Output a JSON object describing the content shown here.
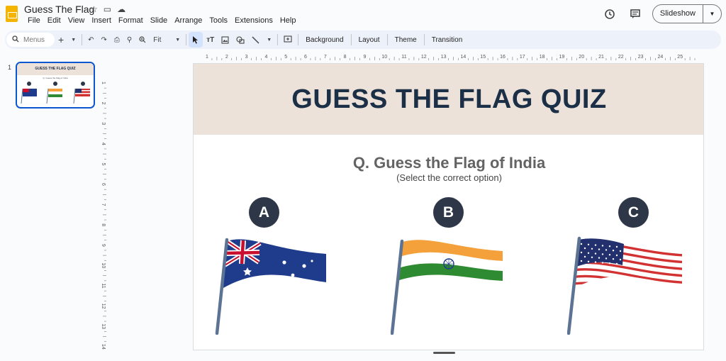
{
  "app": {
    "doc_title": "Guess The Flag",
    "menu": [
      "File",
      "Edit",
      "View",
      "Insert",
      "Format",
      "Slide",
      "Arrange",
      "Tools",
      "Extensions",
      "Help"
    ],
    "slideshow_label": "Slideshow"
  },
  "toolbar": {
    "search_placeholder": "Menus",
    "zoom": "Fit",
    "background_label": "Background",
    "layout_label": "Layout",
    "theme_label": "Theme",
    "transition_label": "Transition"
  },
  "filmstrip": {
    "slide_number": "1",
    "thumb_title": "GUESS THE FLAG QUIZ",
    "thumb_question": "Q. Guess the Flag of India"
  },
  "ruler": {
    "h_ticks": [
      "1",
      "2",
      "3",
      "4",
      "5",
      "6",
      "7",
      "8",
      "9",
      "10",
      "11",
      "12",
      "13",
      "14",
      "15",
      "16",
      "17",
      "18",
      "19",
      "20",
      "21",
      "22",
      "23",
      "24",
      "25"
    ],
    "v_ticks": [
      "1",
      "2",
      "3",
      "4",
      "5",
      "6",
      "7",
      "8",
      "9",
      "10",
      "11",
      "12",
      "13",
      "14"
    ]
  },
  "slide": {
    "title": "GUESS THE FLAG QUIZ",
    "question": "Q. Guess the Flag of India",
    "hint": "(Select the correct option)",
    "options": [
      {
        "letter": "A",
        "flag": "australia-flag"
      },
      {
        "letter": "B",
        "flag": "india-flag"
      },
      {
        "letter": "C",
        "flag": "usa-flag"
      }
    ]
  },
  "colors": {
    "header_bg": "#ede2da",
    "title_color": "#1b2f47",
    "option_circle": "#2d3748",
    "accent_blue": "#0b57d0"
  }
}
